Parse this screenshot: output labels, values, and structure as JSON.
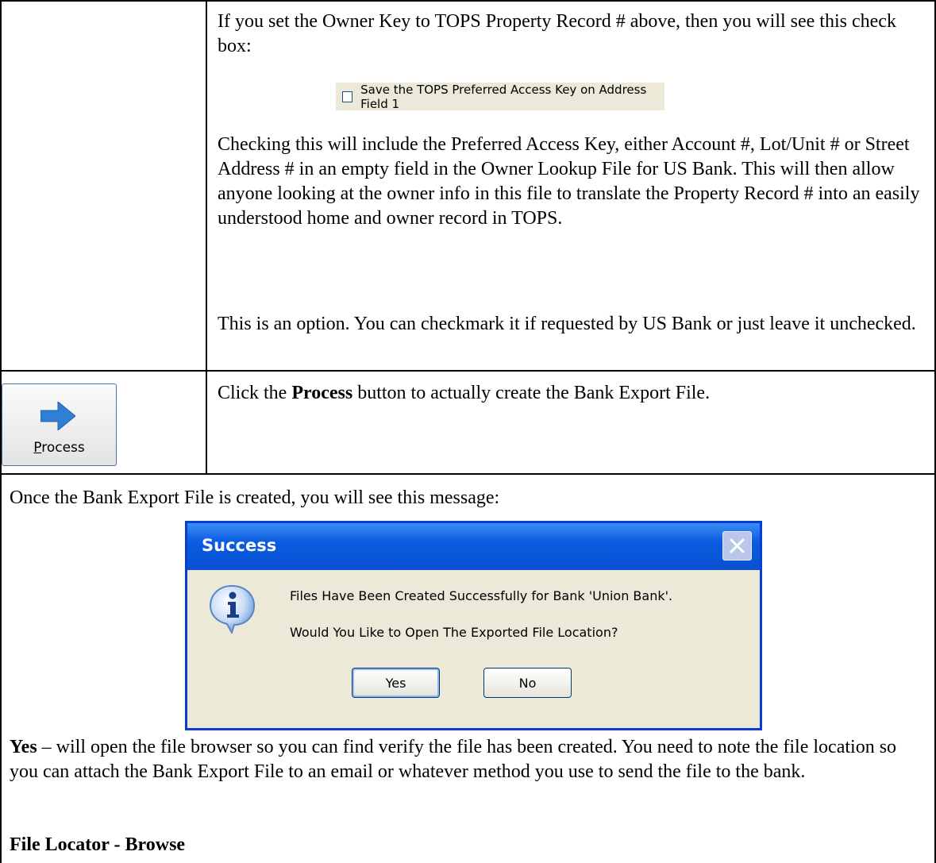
{
  "row1": {
    "intro": "If you set the Owner Key to TOPS Property Record # above, then you will see this check box:",
    "checkbox_label": "Save the TOPS Preferred Access Key on Address Field 1",
    "checkbox_checked": false,
    "para2": "Checking this will include the Preferred Access Key, either Account #, Lot/Unit # or Street Address # in an empty field in the Owner Lookup File for US Bank.  This will then allow anyone looking at the owner info in this file to translate the Property Record # into an easily understood home and owner record in TOPS.",
    "para3": "This is an option.  You can checkmark it if requested by US Bank or just leave it unchecked."
  },
  "row2": {
    "button_label_underlined": "P",
    "button_label_rest": "rocess",
    "text_before": "Click the ",
    "text_bold": "Process",
    "text_after": " button to actually create the Bank Export File."
  },
  "row3": {
    "intro": "Once the Bank Export File is created, you will see this message:",
    "dialog": {
      "title": "Success",
      "message1": "Files Have Been Created Successfully for Bank 'Union Bank'.",
      "message2": "Would You Like to Open The Exported File Location?",
      "yes_label": "Yes",
      "no_label": "No",
      "icon": "info-icon"
    },
    "yes_bold": "Yes",
    "yes_text": " – will open the file browser so you can find verify the file has been created.  You need to note the file location so you can attach the Bank Export File to an email or whatever method you use to send the file to the bank.",
    "heading": "File Locator - Browse"
  },
  "colors": {
    "dialog_face": "#ece9d8",
    "dialog_title": "#0a4fd2",
    "arrow": "#2f7fd6"
  }
}
